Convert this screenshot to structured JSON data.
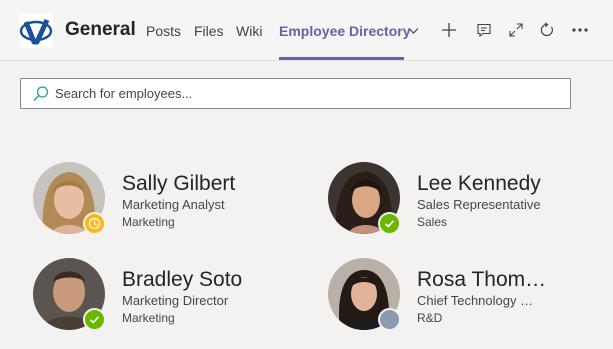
{
  "header": {
    "team_name": "General",
    "tabs": [
      {
        "label": "Posts"
      },
      {
        "label": "Files"
      },
      {
        "label": "Wiki"
      },
      {
        "label": "Employee Directory"
      }
    ],
    "tools": [
      "add-icon",
      "conversation-icon",
      "expand-icon",
      "refresh-icon",
      "more-options-icon"
    ]
  },
  "search": {
    "placeholder": "Search for employees...",
    "value": ""
  },
  "employees": [
    {
      "name": "Sally Gilbert",
      "title": "Marketing Analyst",
      "department": "Marketing",
      "presence": "away"
    },
    {
      "name": "Lee Kennedy",
      "title": "Sales Representative",
      "department": "Sales",
      "presence": "available"
    },
    {
      "name": "Bradley Soto",
      "title": "Marketing Director",
      "department": "Marketing",
      "presence": "available"
    },
    {
      "name": "Rosa Thom…",
      "title": "Chief Technology …",
      "department": "R&D",
      "presence": "offline"
    }
  ],
  "colors": {
    "accent": "#6264a7",
    "away": "#fdb913",
    "available": "#6bb700",
    "offline": "#8a8886",
    "background": "#f3f2f1"
  }
}
